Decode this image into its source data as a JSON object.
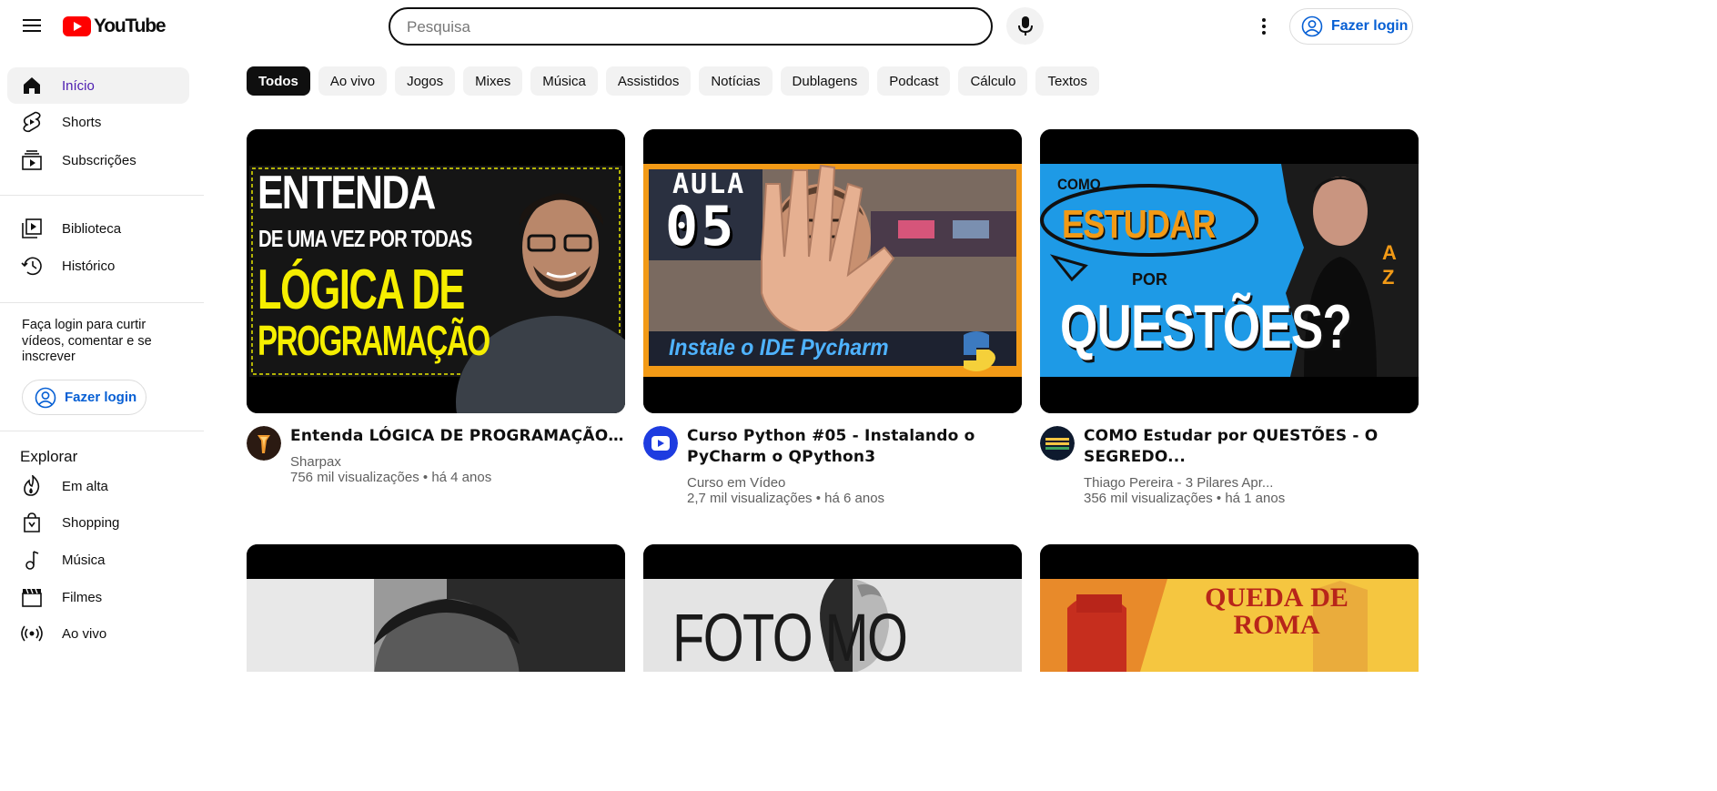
{
  "header": {
    "logo_text": "YouTube",
    "search_placeholder": "Pesquisa",
    "login_label": "Fazer login",
    "brand_color": "#ff0000",
    "link_color": "#065fd4"
  },
  "sidebar": {
    "items": [
      {
        "label": "Início",
        "icon": "home-icon"
      },
      {
        "label": "Shorts",
        "icon": "shorts-icon"
      },
      {
        "label": "Subscrições",
        "icon": "subscriptions-icon"
      }
    ],
    "library_items": [
      {
        "label": "Biblioteca",
        "icon": "library-icon"
      },
      {
        "label": "Histórico",
        "icon": "history-icon"
      }
    ],
    "login_prompt": "Faça login para curtir vídeos, comentar e se inscrever",
    "login_label": "Fazer login",
    "explore_title": "Explorar",
    "explore_items": [
      {
        "label": "Em alta",
        "icon": "trending-icon"
      },
      {
        "label": "Shopping",
        "icon": "shopping-icon"
      },
      {
        "label": "Música",
        "icon": "music-icon"
      },
      {
        "label": "Filmes",
        "icon": "movies-icon"
      },
      {
        "label": "Ao vivo",
        "icon": "live-icon"
      }
    ]
  },
  "chips": [
    "Todos",
    "Ao vivo",
    "Jogos",
    "Mixes",
    "Música",
    "Assistidos",
    "Notícias",
    "Dublagens",
    "Podcast",
    "Cálculo",
    "Textos"
  ],
  "videos": [
    {
      "title": "Entenda LÓGICA DE PROGRAMAÇÃO e...",
      "channel": "Sharpax",
      "meta": "756 mil visualizações • há 4 anos",
      "thumb_text": {
        "l1": "ENTENDA",
        "l2": "DE UMA VEZ POR TODAS",
        "l3": "LÓGICA DE",
        "l4": "PROGRAMAÇÃO"
      }
    },
    {
      "title": "Curso Python #05 - Instalando o PyCharm o QPython3",
      "channel": "Curso em Vídeo",
      "meta": "2,7 mil visualizações • há 6 anos",
      "thumb_text": {
        "l1": "AULA",
        "l2": "05",
        "l3": "Instale o IDE Pycharm"
      }
    },
    {
      "title": "COMO Estudar por QUESTÕES - O SEGREDO...",
      "channel": "Thiago Pereira - 3 Pilares Apr...",
      "meta": "356 mil visualizações • há 1 anos",
      "thumb_text": {
        "l1": "COMO",
        "l2": "ESTUDAR",
        "l3": "POR",
        "l4": "QUESTÕES?",
        "l5": "A",
        "l6": "Z"
      }
    }
  ],
  "second_row": [
    {
      "thumb_text": ""
    },
    {
      "thumb_text": "FOTO MO"
    },
    {
      "thumb_text": "QUEDA DE ROMA"
    }
  ]
}
